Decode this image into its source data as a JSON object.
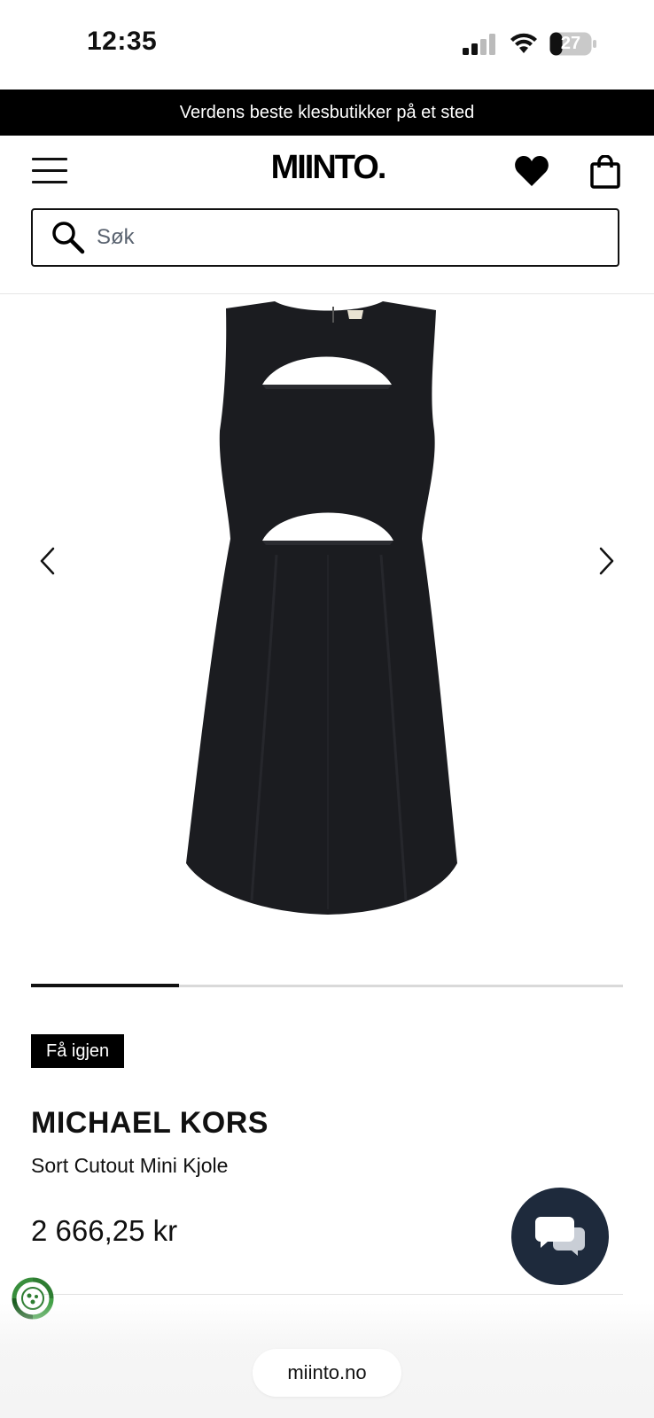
{
  "status_bar": {
    "time": "12:35",
    "battery": "27"
  },
  "promo": {
    "text": "Verdens beste klesbutikker på et sted"
  },
  "header": {
    "logo": "MIINTO."
  },
  "search": {
    "placeholder": "Søk"
  },
  "carousel": {
    "progress": 0.25,
    "current_slide": 1,
    "total_slides": 4
  },
  "product": {
    "badge": "Få igjen",
    "brand": "MICHAEL KORS",
    "name": "Sort Cutout Mini Kjole",
    "price": "2 666,25 kr"
  },
  "browser": {
    "url": "miinto.no"
  },
  "colors": {
    "promo_bg": "#000000",
    "chat_button": "#1e2a3c",
    "eco_green": "#2e7d32"
  },
  "icons": [
    "menu-icon",
    "heart-icon",
    "bag-icon",
    "search-icon",
    "chevron-left-icon",
    "chevron-right-icon",
    "chat-icon",
    "eco-icon"
  ]
}
